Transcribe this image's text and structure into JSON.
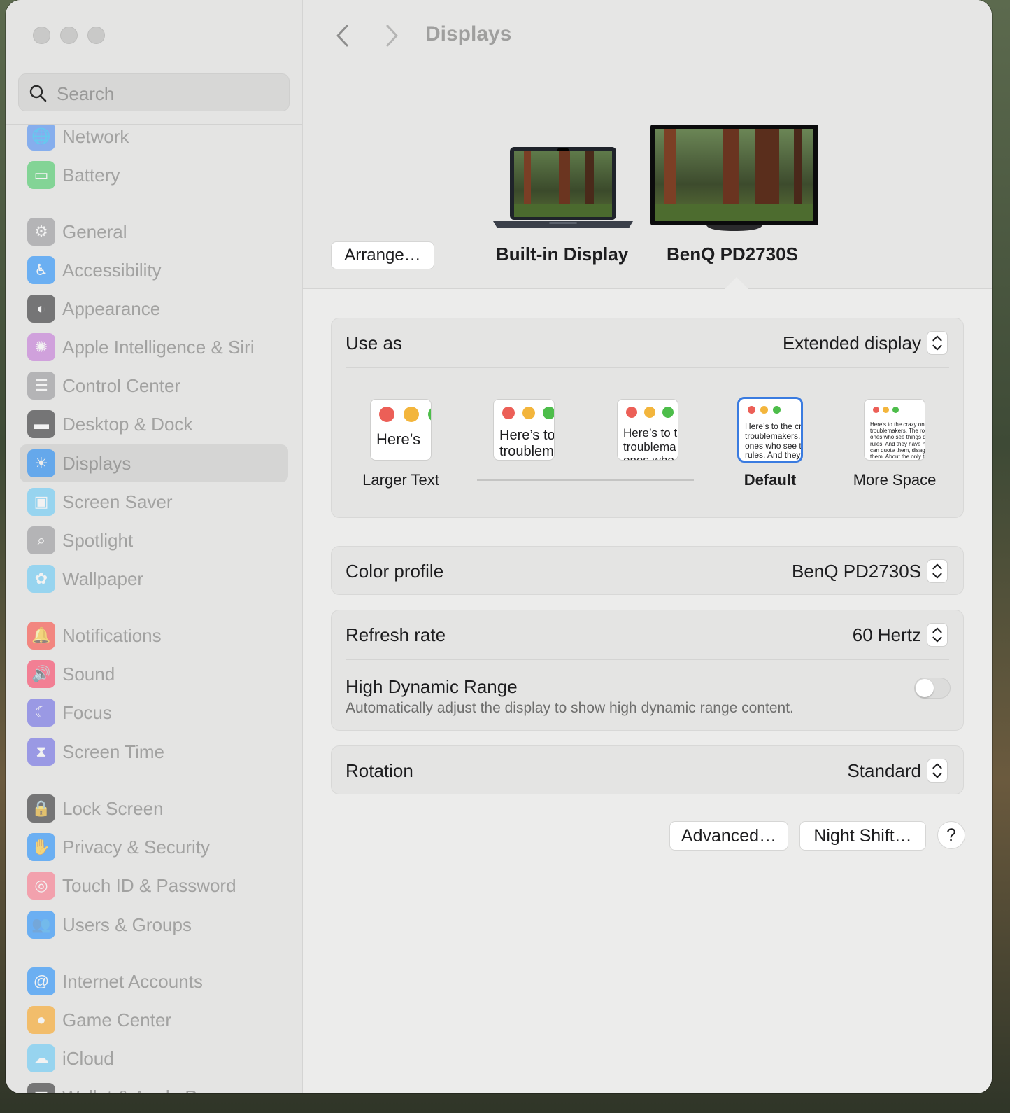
{
  "window": {
    "title": "Displays"
  },
  "search": {
    "placeholder": "Search"
  },
  "sidebar": {
    "items": [
      {
        "label": "Network",
        "icon": "globe-icon",
        "color": "#3b82f6"
      },
      {
        "label": "Battery",
        "icon": "battery-icon",
        "color": "#34c759"
      },
      {
        "label": "General",
        "icon": "gear-icon",
        "color": "#8e8e93"
      },
      {
        "label": "Accessibility",
        "icon": "accessibility-icon",
        "color": "#0a84ff"
      },
      {
        "label": "Appearance",
        "icon": "appearance-icon",
        "color": "#1c1c1e"
      },
      {
        "label": "Apple Intelligence & Siri",
        "icon": "siri-icon",
        "color": "#c06bd8"
      },
      {
        "label": "Control Center",
        "icon": "control-center-icon",
        "color": "#8e8e93"
      },
      {
        "label": "Desktop & Dock",
        "icon": "dock-icon",
        "color": "#1c1c1e"
      },
      {
        "label": "Displays",
        "icon": "sun-icon",
        "color": "#0a84ff"
      },
      {
        "label": "Screen Saver",
        "icon": "screen-saver-icon",
        "color": "#5ac8fa"
      },
      {
        "label": "Spotlight",
        "icon": "spotlight-icon",
        "color": "#8e8e93"
      },
      {
        "label": "Wallpaper",
        "icon": "flower-icon",
        "color": "#5ac8fa"
      },
      {
        "label": "Notifications",
        "icon": "bell-icon",
        "color": "#ff3b30"
      },
      {
        "label": "Sound",
        "icon": "speaker-icon",
        "color": "#ff2d55"
      },
      {
        "label": "Focus",
        "icon": "moon-icon",
        "color": "#5e5ce6"
      },
      {
        "label": "Screen Time",
        "icon": "hourglass-icon",
        "color": "#5e5ce6"
      },
      {
        "label": "Lock Screen",
        "icon": "lock-icon",
        "color": "#1c1c1e"
      },
      {
        "label": "Privacy & Security",
        "icon": "hand-icon",
        "color": "#0a84ff"
      },
      {
        "label": "Touch ID & Password",
        "icon": "fingerprint-icon",
        "color": "#ff6b81"
      },
      {
        "label": "Users & Groups",
        "icon": "users-icon",
        "color": "#0a84ff"
      },
      {
        "label": "Internet Accounts",
        "icon": "at-icon",
        "color": "#0a84ff"
      },
      {
        "label": "Game Center",
        "icon": "game-center-icon",
        "color": "#ff9f0a"
      },
      {
        "label": "iCloud",
        "icon": "cloud-icon",
        "color": "#5ac8fa"
      },
      {
        "label": "Wallet & Apple Pay",
        "icon": "wallet-icon",
        "color": "#1c1c1e"
      }
    ],
    "selected": "Displays"
  },
  "displays": {
    "arrange_label": "Arrange…",
    "builtin_label": "Built-in Display",
    "external_label": "BenQ PD2730S"
  },
  "use_as": {
    "label": "Use as",
    "value": "Extended display"
  },
  "resolution": {
    "options": [
      {
        "label": "Larger Text",
        "preview": "Here’s"
      },
      {
        "label": "",
        "preview": "Here’s to\ntroublem"
      },
      {
        "label": "",
        "preview": "Here’s to t\ntroublema\nones who"
      },
      {
        "label": "Default",
        "preview": "Here’s to the cr\ntroublemakers.\nones who see t\nrules. And they"
      },
      {
        "label": "More Space",
        "preview": "Here’s to the crazy one\ntroublemakers. The rou\nones who see things dif\nrules. And they have no\ncan quote them, disagre\nthem. About the only th\nBecause they change th"
      }
    ],
    "selected": "Default"
  },
  "color_profile": {
    "label": "Color profile",
    "value": "BenQ PD2730S"
  },
  "refresh_rate": {
    "label": "Refresh rate",
    "value": "60 Hertz"
  },
  "hdr": {
    "label": "High Dynamic Range",
    "description": "Automatically adjust the display to show high dynamic range content.",
    "enabled": false
  },
  "rotation": {
    "label": "Rotation",
    "value": "Standard"
  },
  "buttons": {
    "advanced": "Advanced…",
    "night_shift": "Night Shift…",
    "help": "?"
  }
}
